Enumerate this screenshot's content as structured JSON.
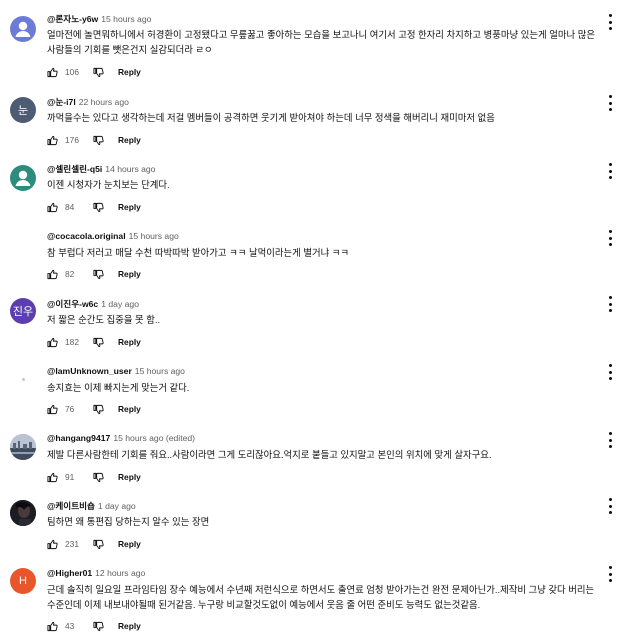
{
  "comments": [
    {
      "handle": "@론자노-y6w",
      "time": "15 hours ago",
      "text": "얼마전에 놀면뭐하니에서 허경환이 고정됐다고 무릎꿇고 좋아하는 모습을 보고나니 여기서 고정 한자리 차지하고 병풍마냥 있는게 얼마나 많은 사람들의 기회를 뺏은건지 실감되더라 ㄹㅇ",
      "likes": "106",
      "reply_label": "Reply",
      "avatar": {
        "kind": "person-icon",
        "bg": "#6d7bd6"
      }
    },
    {
      "handle": "@눈-i7l",
      "time": "22 hours ago",
      "text": "까먹을수는 있다고 생각하는데 저걸 멤버들이 공격하면 웃기게 받아쳐야 하는데 너무 정색을 해버리니 재미마저 없음",
      "likes": "176",
      "reply_label": "Reply",
      "avatar": {
        "kind": "text",
        "text": "눈",
        "bg": "#4d5b73"
      }
    },
    {
      "handle": "@셀린셀린-q5i",
      "time": "14 hours ago",
      "text": "이젠 시청자가 눈치보는 단계다.",
      "likes": "84",
      "reply_label": "Reply",
      "avatar": {
        "kind": "person-icon",
        "bg": "#2e8c7c"
      }
    },
    {
      "handle": "@cocacola.original",
      "time": "15 hours ago",
      "text": "참 부럽다 저러고 매달 수천 따박따박 받아가고 ㅋㅋ 날먹이라는게 별거냐 ㅋㅋ",
      "likes": "82",
      "reply_label": "Reply",
      "avatar": {
        "kind": "none",
        "bg": "#ffffff"
      }
    },
    {
      "handle": "@이진우-w6c",
      "time": "1 day ago",
      "text": "저 짧은 순간도 집중을 못 함..",
      "likes": "182",
      "reply_label": "Reply",
      "avatar": {
        "kind": "text",
        "text": "진우",
        "bg": "#5b3fb0"
      }
    },
    {
      "handle": "@IamUnknown_user",
      "time": "15 hours ago",
      "text": "송지효는 이제 빠지는게 맞는거 같다.",
      "likes": "76",
      "reply_label": "Reply",
      "avatar": {
        "kind": "dot",
        "bg": "#ffffff"
      }
    },
    {
      "handle": "@hangang9417",
      "time": "15 hours ago (edited)",
      "text": "제발 다른사람한테 기회를 줘요..사람이라면 그게 도리잖아요.억지로 붙들고 있지말고 본인의 위치에 맞게 살자구요.",
      "likes": "91",
      "reply_label": "Reply",
      "avatar": {
        "kind": "photo-city",
        "bg": "#8a94a6"
      }
    },
    {
      "handle": "@케이트비숍",
      "time": "1 day ago",
      "text": "팀하면 왜 통편집 당하는지 알수 있는 장면",
      "likes": "231",
      "reply_label": "Reply",
      "avatar": {
        "kind": "photo-dark",
        "bg": "#1c1c24"
      }
    },
    {
      "handle": "@Higher01",
      "time": "12 hours ago",
      "text": "근데 솔직히 일요일 프라임타임 장수 예능에서 수년째 저런식으로 하면서도 출연료 엄청 받아가는건 완전 문제아닌가..제작비 그냥 갖다 버리는수준인데 이제 내보내야될때 된거같음. 누구랑 비교할것도없이 예능에서 웃음 줄 어떤 준비도 능력도 없는것같음.",
      "likes": "43",
      "reply_label": "Reply",
      "avatar": {
        "kind": "text",
        "text": "H",
        "bg": "#e8572b"
      }
    }
  ]
}
